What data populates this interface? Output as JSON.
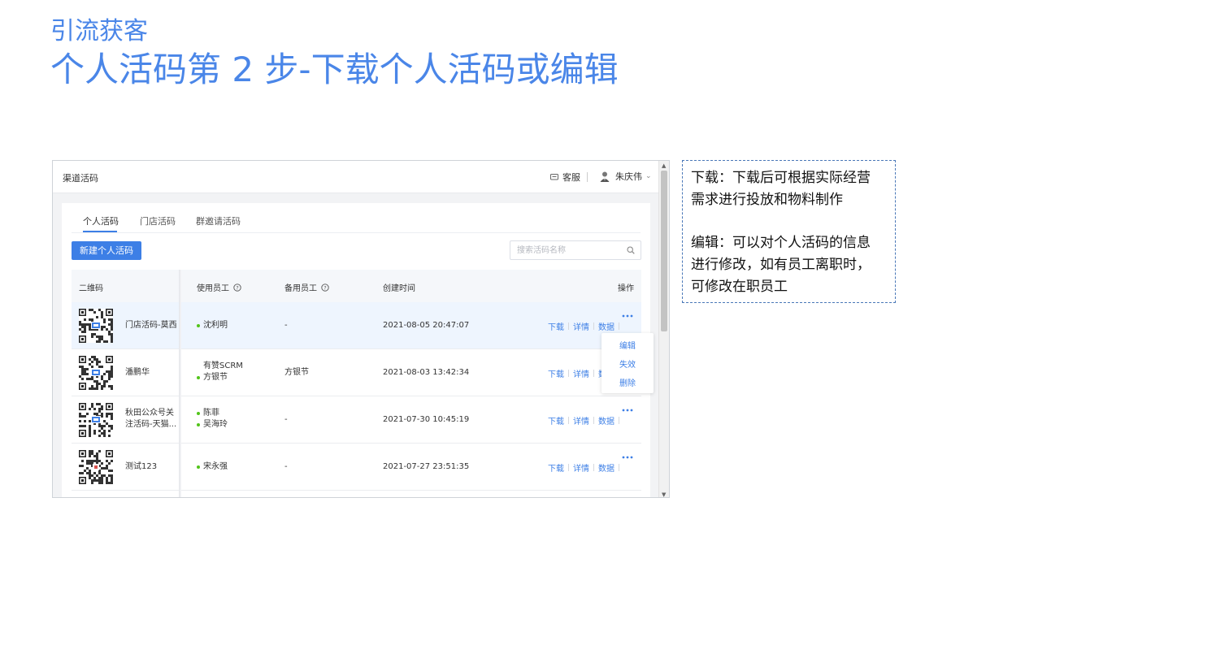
{
  "slide": {
    "subtitle": "引流获客",
    "title": "个人活码第 2 步-下载个人活码或编辑"
  },
  "app": {
    "title": "渠道活码",
    "service_label": "客服",
    "user_name": "朱庆伟"
  },
  "tabs": [
    {
      "label": "个人活码",
      "active": true
    },
    {
      "label": "门店活码",
      "active": false
    },
    {
      "label": "群邀请活码",
      "active": false
    }
  ],
  "toolbar": {
    "new_button_label": "新建个人活码",
    "search_placeholder": "搜索活码名称"
  },
  "table": {
    "columns": [
      "二维码",
      "使用员工",
      "备用员工",
      "创建时间",
      "操作"
    ],
    "rows": [
      {
        "name": "门店活码-莫西",
        "name2": "",
        "staff": [
          "沈利明"
        ],
        "staff_dots": [
          true
        ],
        "backup": "-",
        "created": "2021-08-05 20:47:07"
      },
      {
        "name": "潘鹏华",
        "name2": "",
        "staff": [
          "有赞SCRM",
          "方银节"
        ],
        "staff_dots": [
          false,
          true
        ],
        "backup": "方银节",
        "created": "2021-08-03 13:42:34"
      },
      {
        "name": "秋田公众号关",
        "name2": "注活码-天猫...",
        "staff": [
          "陈菲",
          "吴海玲"
        ],
        "staff_dots": [
          true,
          true
        ],
        "backup": "-",
        "created": "2021-07-30 10:45:19"
      },
      {
        "name": "测试123",
        "name2": "",
        "staff": [
          "宋永强"
        ],
        "staff_dots": [
          true
        ],
        "backup": "-",
        "created": "2021-07-27 23:51:35"
      }
    ],
    "actions": {
      "download": "下载",
      "detail": "详情",
      "data": "数据"
    }
  },
  "dropdown": {
    "items": [
      "编辑",
      "失效",
      "删除"
    ]
  },
  "note": {
    "para1_line1": "下载：下载后可根据实际经营",
    "para1_line2": "需求进行投放和物料制作",
    "para2_line1": "编辑：可以对个人活码的信息",
    "para2_line2": "进行修改，如有员工离职时，",
    "para2_line3": "可修改在职员工"
  },
  "colors": {
    "accent": "#4a86e8",
    "primary_button": "#3d7fe6",
    "online_dot": "#52c41a"
  }
}
